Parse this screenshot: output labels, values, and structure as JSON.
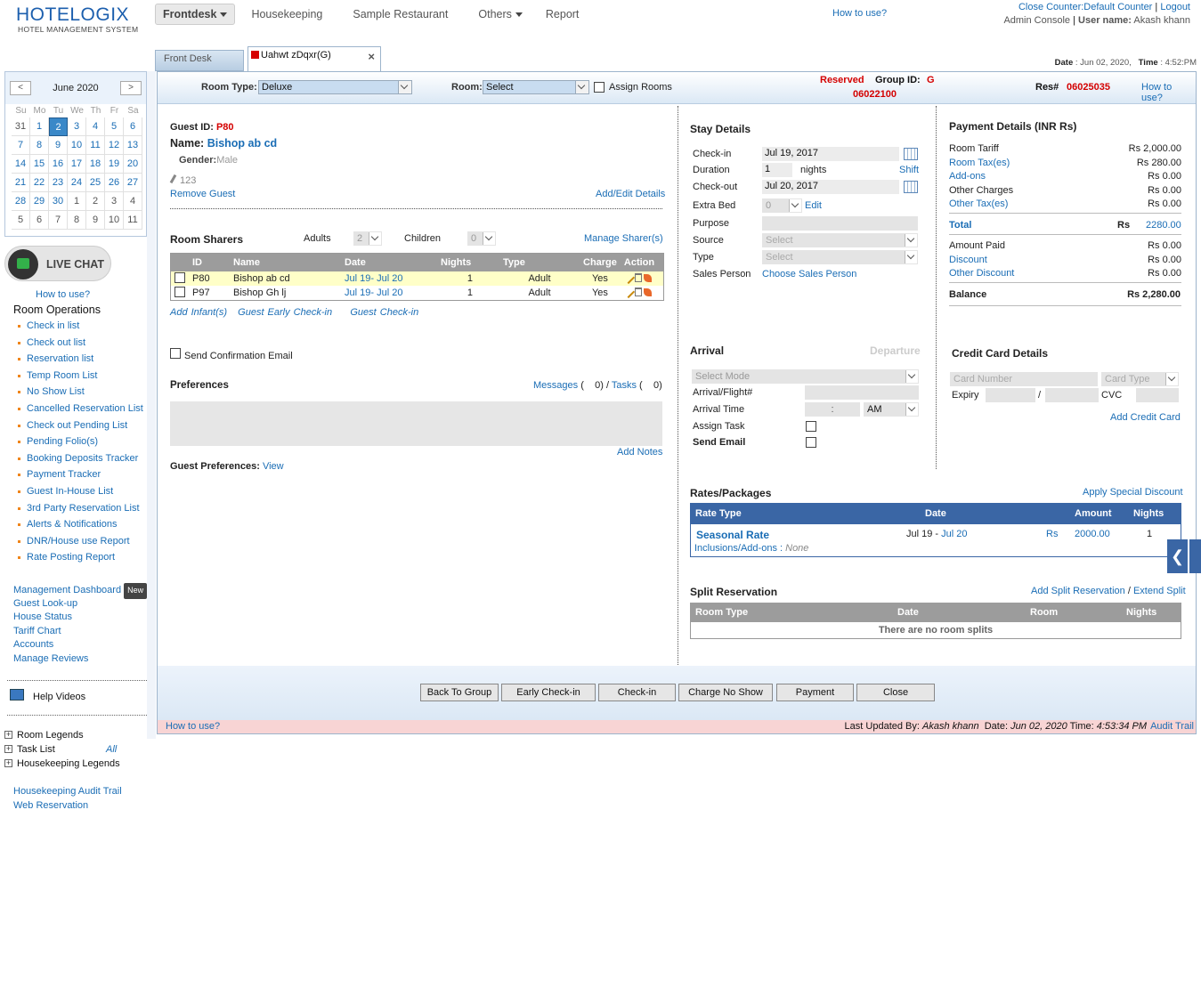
{
  "header": {
    "logo_main_a": "HOTE",
    "logo_main_b": "LOGIX",
    "logo_sub": "HOTEL MANAGEMENT SYSTEM",
    "nav": [
      "Frontdesk",
      "Housekeeping",
      "Sample Restaurant",
      "Others",
      "Report"
    ],
    "how_to_use": "How to use?",
    "close_counter": "Close Counter:Default Counter",
    "logout": "Logout",
    "admin_console": "Admin Console",
    "user_label": "User name:",
    "user_name": "Akash khann",
    "date_label": "Date",
    "date_value": ": Jun 02, 2020,",
    "time_label": "Time",
    "time_value": ": 4:52:PM"
  },
  "calendar": {
    "title": "June 2020",
    "prev": "<",
    "next": ">",
    "days": [
      "Su",
      "Mo",
      "Tu",
      "We",
      "Th",
      "Fr",
      "Sa"
    ],
    "weeks": [
      [
        "31",
        "1",
        "2",
        "3",
        "4",
        "5",
        "6"
      ],
      [
        "7",
        "8",
        "9",
        "10",
        "11",
        "12",
        "13"
      ],
      [
        "14",
        "15",
        "16",
        "17",
        "18",
        "19",
        "20"
      ],
      [
        "21",
        "22",
        "23",
        "24",
        "25",
        "26",
        "27"
      ],
      [
        "28",
        "29",
        "30",
        "1",
        "2",
        "3",
        "4"
      ],
      [
        "5",
        "6",
        "7",
        "8",
        "9",
        "10",
        "11"
      ]
    ]
  },
  "sidebar": {
    "live_chat": "LIVE CHAT",
    "how_to_use": "How to use?",
    "room_ops_title": "Room Operations",
    "room_ops": [
      "Check in list",
      "Check out list",
      "Reservation list",
      "Temp Room List",
      "No Show List",
      "Cancelled Reservation List",
      "Check out Pending List",
      "Pending Folio(s)",
      "Booking Deposits Tracker",
      "Payment Tracker",
      "Guest In-House List",
      "3rd Party Reservation List",
      "Alerts & Notifications",
      "DNR/House use Report",
      "Rate Posting Report"
    ],
    "mgmt": "Management Dashboard",
    "new_badge": "New",
    "links": [
      "Guest Look-up",
      "House Status",
      "Tariff Chart",
      "Accounts",
      "Manage Reviews"
    ],
    "help_videos": "Help Videos",
    "legends": [
      "Room Legends",
      "Task List",
      "Housekeeping Legends"
    ],
    "task_all": "All",
    "bottom_links": [
      "Housekeeping Audit Trail",
      "Web Reservation"
    ]
  },
  "tabs": {
    "front_desk": "Front Desk",
    "reservation": "Uahwt zDqxr(G)",
    "close": "×"
  },
  "topbar": {
    "room_type_label": "Room Type:",
    "room_type_value": "Deluxe",
    "room_label": "Room:",
    "room_value": "Select",
    "assign_rooms": "Assign Rooms",
    "status": "Reserved",
    "group_id_label": "Group ID:",
    "group_id_a": "G",
    "group_id_b": "06022100",
    "res_label": "Res#",
    "res_value": "06025035",
    "how_to_use": "How to use?"
  },
  "guest": {
    "id_label": "Guest ID:",
    "id_value": "P80",
    "name_label": "Name:",
    "name_value": "Bishop ab cd",
    "gender_label": "Gender:",
    "gender_value": "Male",
    "phone": "123",
    "remove": "Remove Guest",
    "add_edit": "Add/Edit Details"
  },
  "sharers": {
    "title": "Room Sharers",
    "adults_label": "Adults",
    "adults_value": "2",
    "children_label": "Children",
    "children_value": "0",
    "manage": "Manage Sharer(s)",
    "columns": [
      "ID",
      "Name",
      "Date",
      "Nights",
      "Type",
      "Charge",
      "Action"
    ],
    "rows": [
      {
        "id": "P80",
        "name": "Bishop ab cd",
        "date_from": "Jul 19",
        "date_to": "Jul 20",
        "nights": "1",
        "type": "Adult",
        "charge": "Yes"
      },
      {
        "id": "P97",
        "name": "Bishop Gh lj",
        "date_from": "Jul 19",
        "date_to": "Jul 20",
        "nights": "1",
        "type": "Adult",
        "charge": "Yes"
      }
    ],
    "add_infant": "Add Infant(s)",
    "early_checkin": "Guest Early Check-in",
    "guest_checkin": "Guest Check-in"
  },
  "confirmation": "Send Confirmation Email",
  "preferences": {
    "title": "Preferences",
    "messages": "Messages",
    "messages_count": "0",
    "tasks": "Tasks",
    "tasks_count": "0",
    "add_notes": "Add Notes",
    "guest_pref_label": "Guest Preferences:",
    "view": "View"
  },
  "stay": {
    "title": "Stay Details",
    "checkin_label": "Check-in",
    "checkin_value": "Jul 19, 2017",
    "duration_label": "Duration",
    "duration_value": "1",
    "nights": "nights",
    "shift": "Shift",
    "checkout_label": "Check-out",
    "checkout_value": "Jul 20, 2017",
    "extra_bed_label": "Extra Bed",
    "extra_bed_value": "0",
    "edit": "Edit",
    "purpose_label": "Purpose",
    "source_label": "Source",
    "source_value": "Select",
    "type_label": "Type",
    "type_value": "Select",
    "sales_label": "Sales Person",
    "sales_value": "Choose Sales Person"
  },
  "arrival": {
    "title": "Arrival",
    "departure": "Departure",
    "mode": "Select Mode",
    "flight_label": "Arrival/Flight#",
    "time_label": "Arrival Time",
    "time_sep": ":",
    "ampm": "AM",
    "assign_task": "Assign Task",
    "send_email": "Send Email"
  },
  "payment": {
    "title": "Payment Details (INR Rs)",
    "rows": [
      {
        "label": "Room Tariff",
        "value": "Rs 2,000.00",
        "link": false
      },
      {
        "label": "Room Tax(es)",
        "value": "Rs 280.00",
        "link": true
      },
      {
        "label": "Add-ons",
        "value": "Rs 0.00",
        "link": true
      },
      {
        "label": "Other Charges",
        "value": "Rs 0.00",
        "link": false
      },
      {
        "label": "Other Tax(es)",
        "value": "Rs 0.00",
        "link": true
      }
    ],
    "total_label": "Total",
    "total_rs": "Rs",
    "total_value": "2280.00",
    "rows2": [
      {
        "label": "Amount Paid",
        "value": "Rs 0.00",
        "link": false
      },
      {
        "label": "Discount",
        "value": "Rs 0.00",
        "link": true
      },
      {
        "label": "Other Discount",
        "value": "Rs 0.00",
        "link": true
      }
    ],
    "balance_label": "Balance",
    "balance_value": "Rs 2,280.00"
  },
  "credit_card": {
    "title": "Credit Card Details",
    "number_placeholder": "Card Number",
    "type_placeholder": "Card Type",
    "expiry": "Expiry",
    "slash": "/",
    "cvc": "CVC",
    "add": "Add Credit Card"
  },
  "rates": {
    "title": "Rates/Packages",
    "special": "Apply Special Discount",
    "columns": [
      "Rate Type",
      "Date",
      "Amount",
      "Nights"
    ],
    "rate_name": "Seasonal Rate",
    "date_from": "Jul 19 -",
    "date_to": "Jul 20",
    "currency": "Rs",
    "amount": "2000.00",
    "nights": "1",
    "incl_label": "Inclusions/Add-ons :",
    "incl_value": "None"
  },
  "split": {
    "title": "Split Reservation",
    "add": "Add Split Reservation",
    "sep": "/",
    "extend": "Extend Split",
    "columns": [
      "Room Type",
      "Date",
      "Room",
      "Nights"
    ],
    "empty": "There are no room splits"
  },
  "buttons": [
    "Back To Group",
    "Early Check-in",
    "Check-in",
    "Charge No Show",
    "Payment",
    "Close"
  ],
  "footer": {
    "how_to_use": "How to use?",
    "updated_label": "Last Updated By:",
    "updated_by": "Akash khann",
    "date_label": "Date:",
    "date_value": "Jun 02, 2020",
    "time_label": "Time:",
    "time_value": "4:53:34 PM",
    "audit": "Audit Trail"
  },
  "side_tab": "❮"
}
